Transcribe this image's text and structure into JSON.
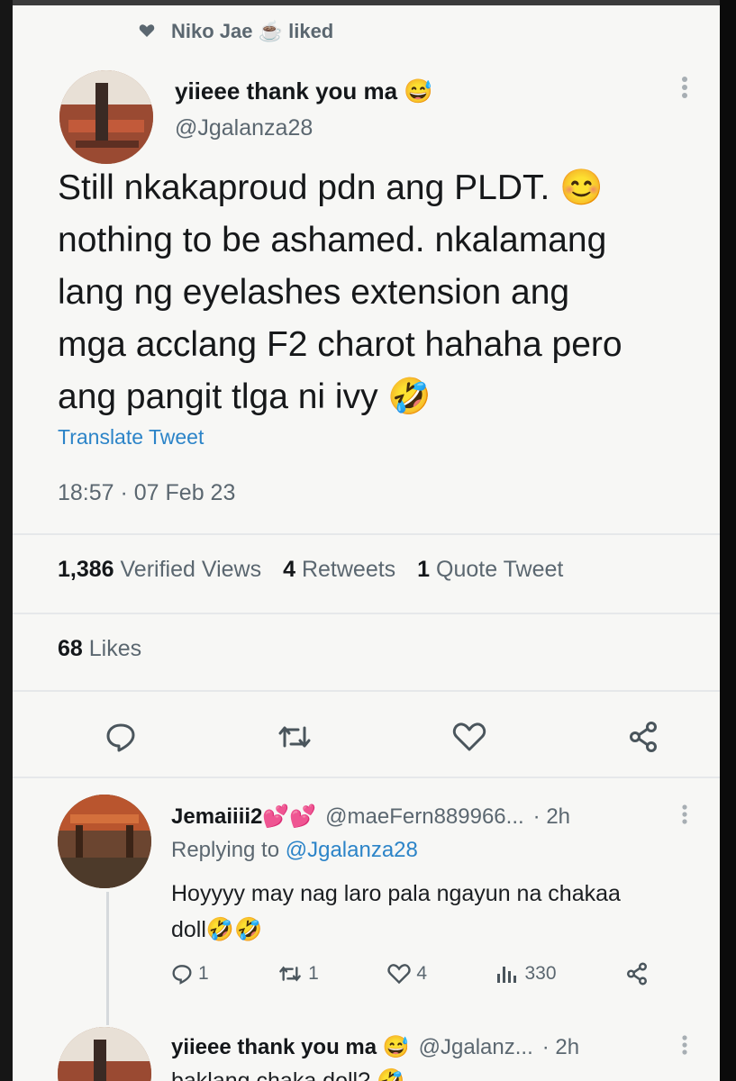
{
  "context": {
    "liked_text": "Niko Jae ☕ liked"
  },
  "tweet": {
    "display_name": "yiieee thank you ma 😅",
    "handle": "@Jgalanza28",
    "lines": [
      "Still nkakaproud pdn ang PLDT. 😊",
      "nothing to be ashamed. nkalamang",
      "lang ng eyelashes extension ang",
      "mga acclang F2 charot hahaha pero",
      "ang pangit tlga ni ivy 🤣"
    ],
    "translate_label": "Translate Tweet",
    "timestamp": "18:57 · 07 Feb 23",
    "views_count": "1,386",
    "views_label": "Verified Views",
    "retweets_count": "4",
    "retweets_label": "Retweets",
    "quotes_count": "1",
    "quotes_label": "Quote Tweet",
    "likes_count": "68",
    "likes_label": "Likes"
  },
  "icons": {
    "reply": "reply-icon",
    "retweet": "retweet-icon",
    "like": "heart-icon",
    "share": "share-icon",
    "more": "more-options-icon",
    "views": "views-icon"
  },
  "reply": {
    "display_name": "Jemaiiii2💕💕",
    "handle": "@maeFern889966...",
    "time": "· 2h",
    "replying_prefix": "Replying to",
    "replying_handle": "@Jgalanza28",
    "text_line1": "Hoyyyy may nag laro pala ngayun na chakaa",
    "text_line2": "doll🤣🤣",
    "reply_count": "1",
    "retweet_count": "1",
    "like_count": "4",
    "views_count": "330"
  },
  "reply2": {
    "display_name": "yiieee thank you ma 😅",
    "handle": "@Jgalanz...",
    "time": "· 2h",
    "text_partial": "baklang chaka doll? 🤣"
  },
  "colors": {
    "accent": "#2c84c8",
    "muted": "#5b6770",
    "background": "#f7f7f5"
  }
}
